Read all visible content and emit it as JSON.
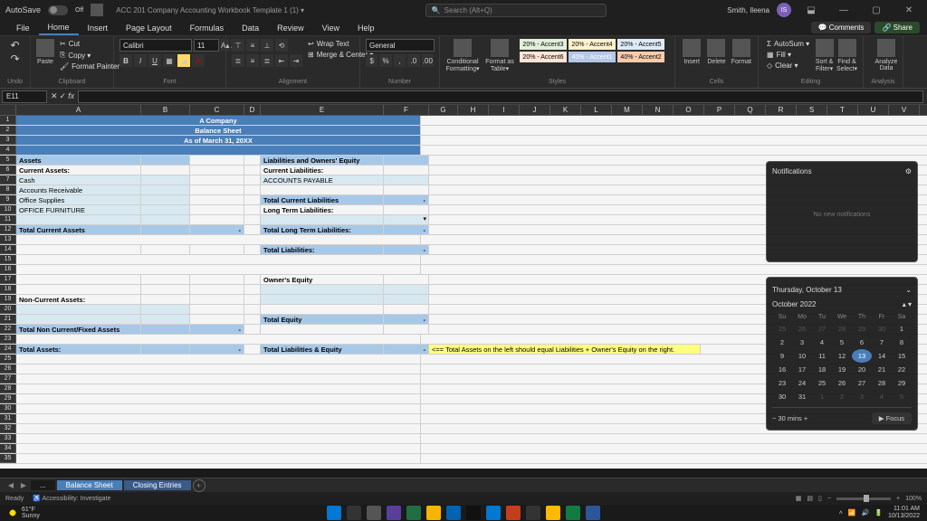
{
  "titlebar": {
    "autosave": "AutoSave",
    "autosave_state": "Off",
    "filename": "ACC 201 Company Accounting Workbook Template 1 (1) ▾",
    "search_placeholder": "Search (Alt+Q)",
    "username": "Smith, Ileena",
    "user_initials": "IS"
  },
  "ribbon_tabs": [
    "File",
    "Home",
    "Insert",
    "Page Layout",
    "Formulas",
    "Data",
    "Review",
    "View",
    "Help"
  ],
  "ribbon_right": {
    "comments": "Comments",
    "share": "Share"
  },
  "ribbon": {
    "undo": "Undo",
    "clipboard": {
      "cut": "Cut",
      "copy": "Copy ▾",
      "paste": "Paste",
      "painter": "Format Painter",
      "label": "Clipboard"
    },
    "font": {
      "name": "Calibri",
      "size": "11",
      "label": "Font"
    },
    "alignment": {
      "wrap": "Wrap Text",
      "merge": "Merge & Center ▾",
      "label": "Alignment"
    },
    "number": {
      "format": "General",
      "label": "Number"
    },
    "styles": {
      "cond": "Conditional Formatting▾",
      "table": "Format as Table▾",
      "s1": "20% - Accent3",
      "s2": "20% - Accent4",
      "s3": "20% - Accent5",
      "s4": "20% - Accent6",
      "s5": "40% - Accent1",
      "s6": "40% - Accent2",
      "label": "Styles"
    },
    "cells": {
      "insert": "Insert",
      "delete": "Delete",
      "format": "Format",
      "label": "Cells"
    },
    "editing": {
      "autosum": "AutoSum ▾",
      "fill": "Fill ▾",
      "clear": "Clear ▾",
      "sort": "Sort & Filter▾",
      "find": "Find & Select▾",
      "label": "Editing"
    },
    "analysis": {
      "analyze": "Analyze Data",
      "label": "Analysis"
    }
  },
  "formula_bar": {
    "name_box": "E11"
  },
  "columns": [
    "A",
    "B",
    "C",
    "D",
    "E",
    "F",
    "G",
    "H",
    "I",
    "J",
    "K",
    "L",
    "M",
    "N",
    "O",
    "P",
    "Q",
    "R",
    "S",
    "T",
    "U",
    "V"
  ],
  "sheet": {
    "title1": "A Company",
    "title2": "Balance Sheet",
    "title3": "As of March 31, 20XX",
    "assets_h": "Assets",
    "cur_assets": "Current Assets:",
    "cash": "Cash",
    "ar": "Accounts Receivable",
    "supplies": "Office Supplies",
    "furn": "OFFICE FURNITURE",
    "tot_cur": "Total Current Assets",
    "dash": "-",
    "noncur": "Non-Current Assets:",
    "tot_noncur": "Total Non Current/Fixed Assets",
    "tot_assets": "Total Assets:",
    "liab_h": "Liabilities and Owners' Equity",
    "cur_liab": "Current Liabilities:",
    "ap": "ACCOUNTS PAYABLE",
    "tot_cur_liab": "Total Current Liabilities",
    "lt_liab": "Long Term Liabilities:",
    "tot_lt": "Total Long Term Liabilities:",
    "tot_liab": "Total Liabilities:",
    "oe": "Owner's Equity",
    "tot_eq": "Total Equity",
    "tot_le": "Total Liabilities & Equity",
    "note": "<== Total Assets on the left should equal Liabilities + Owner's Equity on the right."
  },
  "sheet_tabs": {
    "t1": "...",
    "t2": "Balance Sheet",
    "t3": "Closing Entries"
  },
  "status": {
    "ready": "Ready",
    "acc": "Accessibility: Investigate",
    "focus_mins": "30 mins",
    "focus": "Focus",
    "zoom": "100%"
  },
  "notifications": {
    "title": "Notifications",
    "empty": "No new notifications"
  },
  "calendar": {
    "today_long": "Thursday, October 13",
    "month": "October 2022",
    "dow": [
      "Su",
      "Mo",
      "Tu",
      "We",
      "Th",
      "Fr",
      "Sa"
    ],
    "weeks": [
      [
        {
          "n": "25",
          "dim": true
        },
        {
          "n": "26",
          "dim": true
        },
        {
          "n": "27",
          "dim": true
        },
        {
          "n": "28",
          "dim": true
        },
        {
          "n": "29",
          "dim": true
        },
        {
          "n": "30",
          "dim": true
        },
        {
          "n": "1"
        }
      ],
      [
        {
          "n": "2"
        },
        {
          "n": "3"
        },
        {
          "n": "4"
        },
        {
          "n": "5"
        },
        {
          "n": "6"
        },
        {
          "n": "7"
        },
        {
          "n": "8"
        }
      ],
      [
        {
          "n": "9"
        },
        {
          "n": "10"
        },
        {
          "n": "11"
        },
        {
          "n": "12"
        },
        {
          "n": "13",
          "today": true
        },
        {
          "n": "14"
        },
        {
          "n": "15"
        }
      ],
      [
        {
          "n": "16"
        },
        {
          "n": "17"
        },
        {
          "n": "18"
        },
        {
          "n": "19"
        },
        {
          "n": "20"
        },
        {
          "n": "21"
        },
        {
          "n": "22"
        }
      ],
      [
        {
          "n": "23"
        },
        {
          "n": "24"
        },
        {
          "n": "25"
        },
        {
          "n": "26"
        },
        {
          "n": "27"
        },
        {
          "n": "28"
        },
        {
          "n": "29"
        }
      ],
      [
        {
          "n": "30"
        },
        {
          "n": "31"
        },
        {
          "n": "1",
          "dim": true
        },
        {
          "n": "2",
          "dim": true
        },
        {
          "n": "3",
          "dim": true
        },
        {
          "n": "4",
          "dim": true
        },
        {
          "n": "5",
          "dim": true
        }
      ]
    ],
    "focus_label": "30 mins",
    "focus_btn": "▶ Focus"
  },
  "taskbar": {
    "temp": "61°F",
    "weather": "Sunny",
    "time": "11:01 AM",
    "date": "10/13/2022"
  }
}
